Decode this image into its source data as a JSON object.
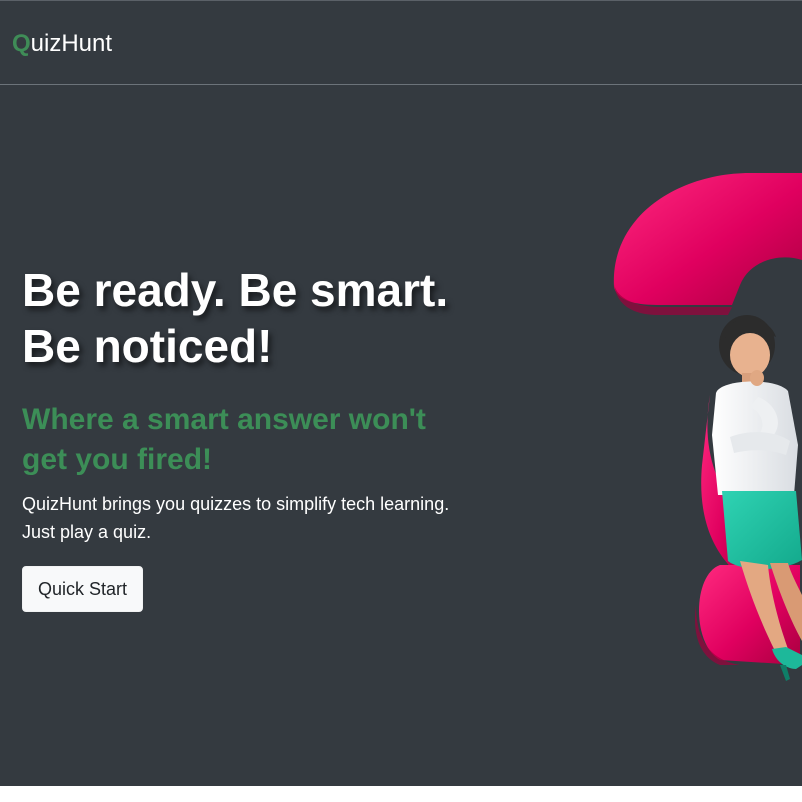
{
  "navbar": {
    "brand_initial": "Q",
    "brand_rest": "uizHunt"
  },
  "hero": {
    "headline_line1": "Be ready. Be smart.",
    "headline_line2": "Be noticed!",
    "subheadline_line1": "Where a smart answer won't",
    "subheadline_line2": "get you fired!",
    "description_line1": "QuizHunt brings you quizzes to simplify tech learning.",
    "description_line2": "Just play a quiz.",
    "cta_label": "Quick Start"
  },
  "colors": {
    "background": "#343a40",
    "accent_green": "#3c8e57",
    "question_mark": "#e0005f",
    "button_bg": "#f8f9fa"
  },
  "icons": {
    "illustration": "question-mark-woman-illustration"
  }
}
